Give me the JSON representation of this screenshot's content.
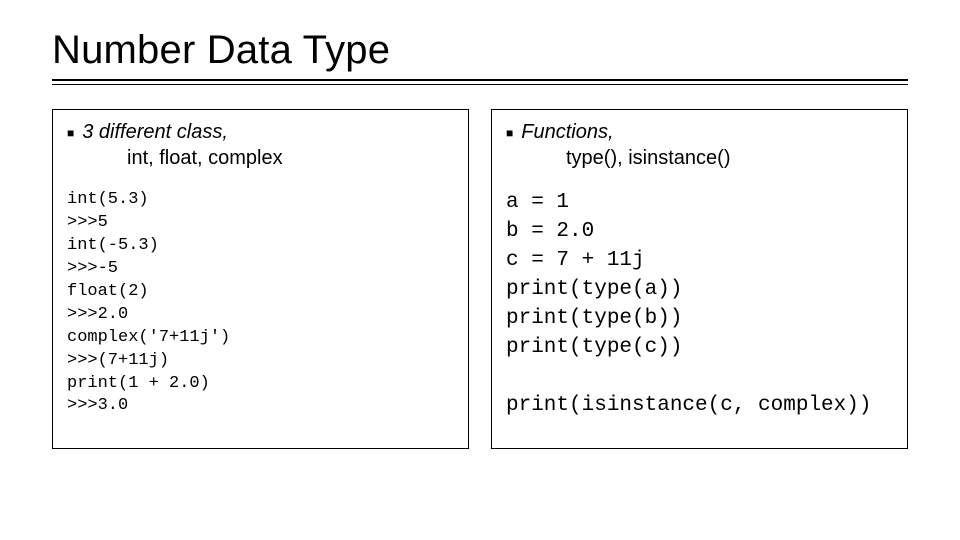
{
  "title": "Number Data Type",
  "left": {
    "bullet": "3 different class,",
    "sub": "int, float, complex",
    "code": "int(5.3)\n>>>5\nint(-5.3)\n>>>-5\nfloat(2)\n>>>2.0\ncomplex('7+11j')\n>>>(7+11j)\nprint(1 + 2.0)\n>>>3.0"
  },
  "right": {
    "bullet": "Functions,",
    "sub": "type(), isinstance()",
    "code": "a = 1\nb = 2.0\nc = 7 + 11j\nprint(type(a))\nprint(type(b))\nprint(type(c))\n\nprint(isinstance(c, complex))"
  }
}
